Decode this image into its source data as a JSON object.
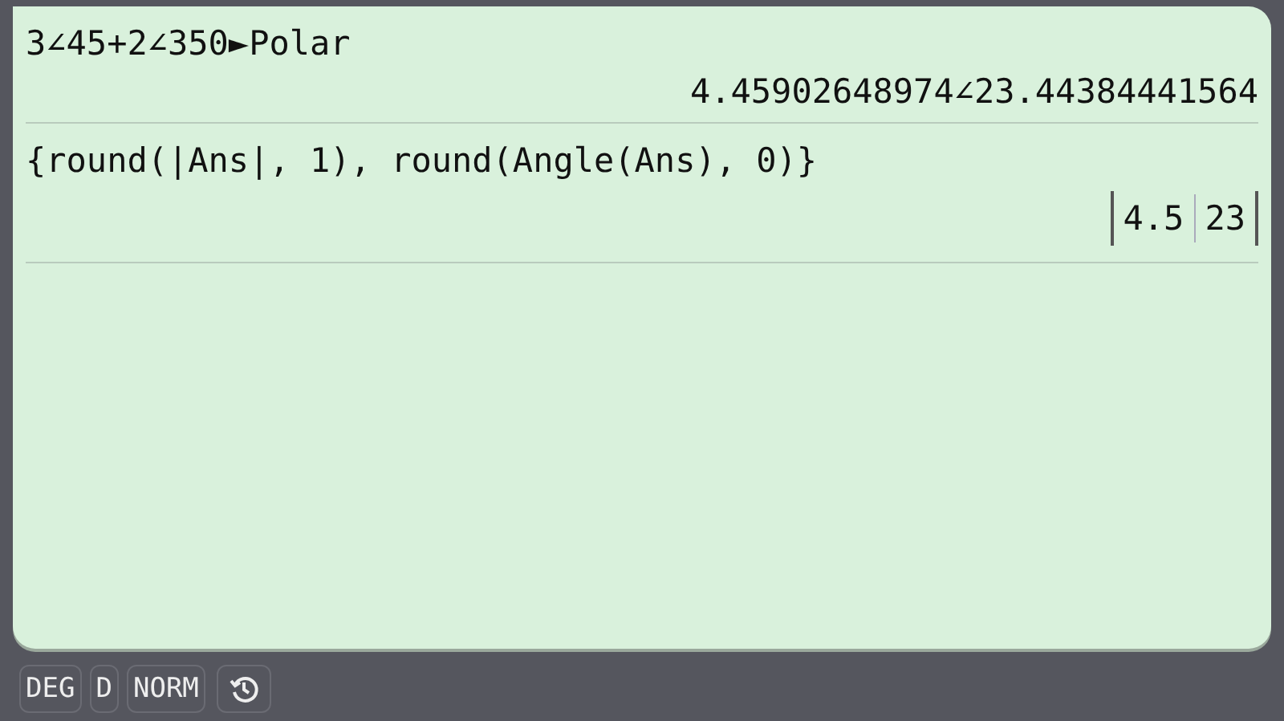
{
  "history": [
    {
      "input": "3∠45+2∠350►Polar",
      "output": {
        "kind": "text",
        "text": "4.45902648974∠23.44384441564"
      }
    },
    {
      "input": "{round(|Ans|, 1), round(Angle(Ans), 0)}",
      "output": {
        "kind": "matrix",
        "cells": [
          "4.5",
          "23"
        ]
      }
    }
  ],
  "status_bar": {
    "buttons": [
      "DEG",
      "D",
      "NORM"
    ]
  }
}
